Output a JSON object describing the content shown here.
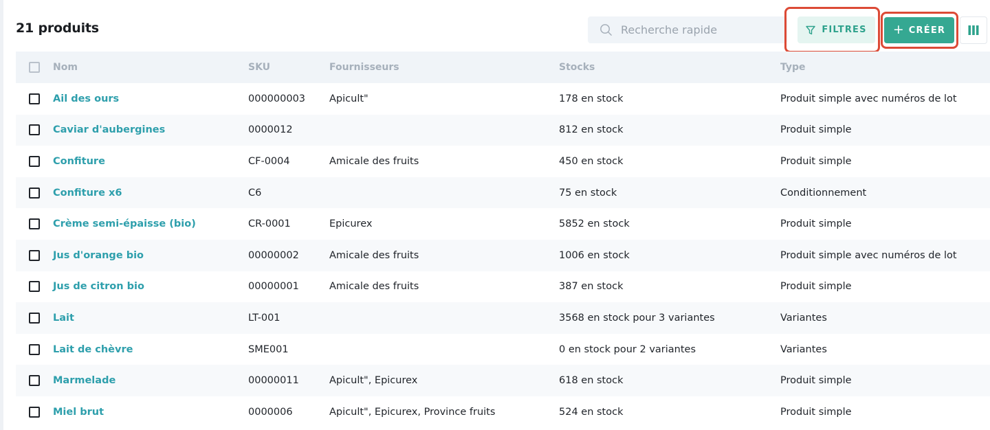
{
  "header": {
    "title": "21 produits",
    "search_placeholder": "Recherche rapide",
    "search_value": "",
    "filters_label": "FILTRES",
    "create_label": "CRÉER",
    "create_plus": "+"
  },
  "colors": {
    "accent": "#35a892",
    "link": "#2e9fac",
    "highlight_box": "#dc4a36",
    "header_bg": "#f0f4f8"
  },
  "icons": {
    "search": "search-icon",
    "filter": "filter-funnel-icon",
    "columns": "columns-icon"
  },
  "table": {
    "columns": [
      "Nom",
      "SKU",
      "Fournisseurs",
      "Stocks",
      "Type"
    ],
    "rows": [
      {
        "name": "Ail des ours",
        "sku": "000000003",
        "suppliers": "Apicult\"",
        "stock": "178 en stock",
        "type": "Produit simple avec numéros de lot"
      },
      {
        "name": "Caviar d'aubergines",
        "sku": "0000012",
        "suppliers": "",
        "stock": "812 en stock",
        "type": "Produit simple"
      },
      {
        "name": "Confiture",
        "sku": "CF-0004",
        "suppliers": "Amicale des fruits",
        "stock": "450 en stock",
        "type": "Produit simple"
      },
      {
        "name": "Confiture x6",
        "sku": "C6",
        "suppliers": "",
        "stock": "75 en stock",
        "type": "Conditionnement"
      },
      {
        "name": "Crème semi-épaisse (bio)",
        "sku": "CR-0001",
        "suppliers": "Epicurex",
        "stock": "5852 en stock",
        "type": "Produit simple"
      },
      {
        "name": "Jus d'orange bio",
        "sku": "00000002",
        "suppliers": "Amicale des fruits",
        "stock": "1006 en stock",
        "type": "Produit simple avec numéros de lot"
      },
      {
        "name": "Jus de citron bio",
        "sku": "00000001",
        "suppliers": "Amicale des fruits",
        "stock": "387 en stock",
        "type": "Produit simple"
      },
      {
        "name": "Lait",
        "sku": "LT-001",
        "suppliers": "",
        "stock": "3568 en stock pour 3 variantes",
        "type": "Variantes"
      },
      {
        "name": "Lait de chèvre",
        "sku": "SME001",
        "suppliers": "",
        "stock": "0 en stock pour 2 variantes",
        "type": "Variantes"
      },
      {
        "name": "Marmelade",
        "sku": "00000011",
        "suppliers": "Apicult\", Epicurex",
        "stock": "618 en stock",
        "type": "Produit simple"
      },
      {
        "name": "Miel brut",
        "sku": "0000006",
        "suppliers": "Apicult\", Epicurex, Province fruits",
        "stock": "524 en stock",
        "type": "Produit simple"
      }
    ]
  }
}
